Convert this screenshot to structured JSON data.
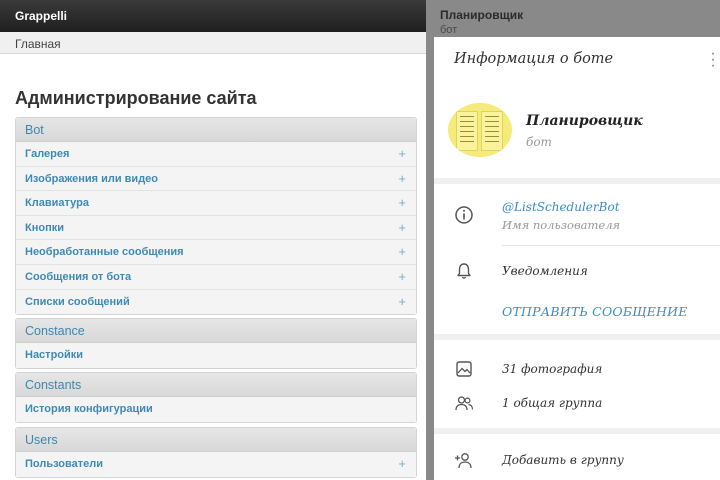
{
  "admin": {
    "app_title": "Grappelli",
    "breadcrumb": "Главная",
    "page_title": "Администрирование сайта",
    "modules": [
      {
        "name": "Bot",
        "items": [
          {
            "label": "Галерея",
            "add": "+"
          },
          {
            "label": "Изображения или видео",
            "add": "+"
          },
          {
            "label": "Клавиатура",
            "add": "+"
          },
          {
            "label": "Кнопки",
            "add": "+"
          },
          {
            "label": "Необработанные сообщения",
            "add": "+"
          },
          {
            "label": "Сообщения от бота",
            "add": "+"
          },
          {
            "label": "Списки сообщений",
            "add": "+"
          }
        ]
      },
      {
        "name": "Constance",
        "items": [
          {
            "label": "Настройки",
            "add": ""
          }
        ]
      },
      {
        "name": "Constants",
        "items": [
          {
            "label": "История конфигурации",
            "add": ""
          }
        ]
      },
      {
        "name": "Users",
        "items": [
          {
            "label": "Пользователи",
            "add": "+"
          }
        ]
      }
    ]
  },
  "telegram": {
    "chat_title": "Планировщик",
    "chat_subtitle": "бот",
    "dialog_title": "Информация о боте",
    "menu_icon": "kebab-menu-icon",
    "bot_name": "Планировщик",
    "bot_type": "бот",
    "username": "@ListSchedulerBot",
    "username_label": "Имя пользователя",
    "notifications_label": "Уведомления",
    "send_message_button": "ОТПРАВИТЬ СООБЩЕНИЕ",
    "photos_label": "31 фотография",
    "groups_label": "1 общая группа",
    "add_to_group_label": "Добавить в группу",
    "colors": {
      "accent": "#3a8cc8",
      "admin_link": "#3f8ab4",
      "avatar": "#f5ea7a"
    }
  }
}
